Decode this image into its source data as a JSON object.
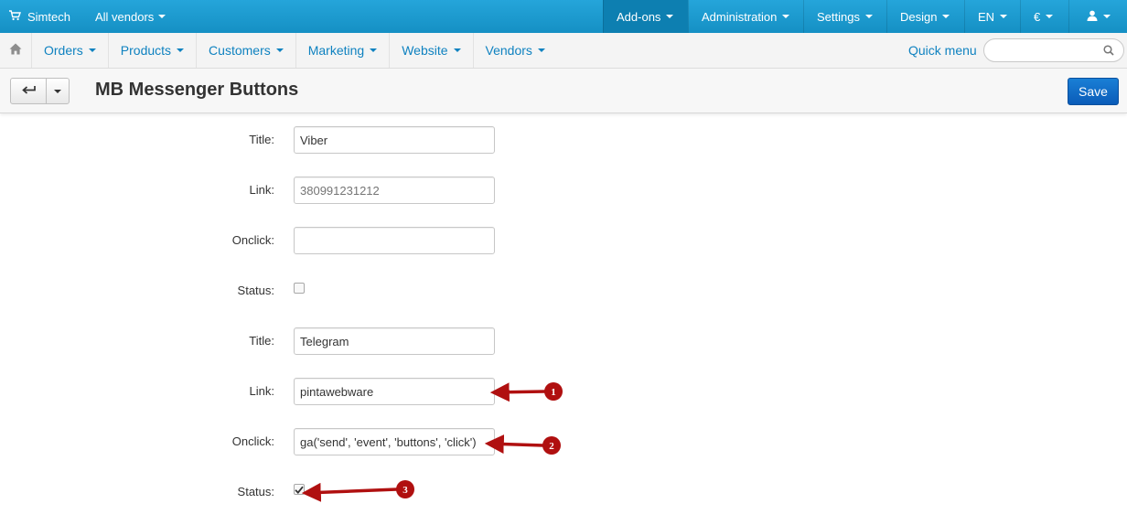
{
  "topbar": {
    "brand": "Simtech",
    "vendor_switch": "All vendors",
    "nav": [
      {
        "label": "Add-ons",
        "active": true
      },
      {
        "label": "Administration"
      },
      {
        "label": "Settings"
      },
      {
        "label": "Design"
      },
      {
        "label": "EN"
      },
      {
        "label": "€"
      }
    ]
  },
  "mainmenu": {
    "items": [
      "Orders",
      "Products",
      "Customers",
      "Marketing",
      "Website",
      "Vendors"
    ],
    "quick_menu": "Quick menu",
    "search_value": ""
  },
  "header": {
    "title": "MB Messenger Buttons",
    "save_label": "Save"
  },
  "form": {
    "viber": {
      "title_label": "Title:",
      "title_value": "Viber",
      "link_label": "Link:",
      "link_placeholder": "380991231212",
      "onclick_label": "Onclick:",
      "onclick_value": "",
      "status_label": "Status:",
      "status_checked": false
    },
    "telegram": {
      "title_label": "Title:",
      "title_value": "Telegram",
      "link_label": "Link:",
      "link_value": "pintawebware",
      "onclick_label": "Onclick:",
      "onclick_value": "ga('send', 'event', 'buttons', 'click')",
      "status_label": "Status:",
      "status_checked": true
    }
  },
  "annotations": {
    "markers": [
      "1",
      "2",
      "3"
    ],
    "color": "#b01010"
  },
  "colors": {
    "topbar": "#1b9bd1",
    "active_tab": "#0d7fb1",
    "link": "#0f82c0",
    "save_button": "#0b63c1"
  }
}
